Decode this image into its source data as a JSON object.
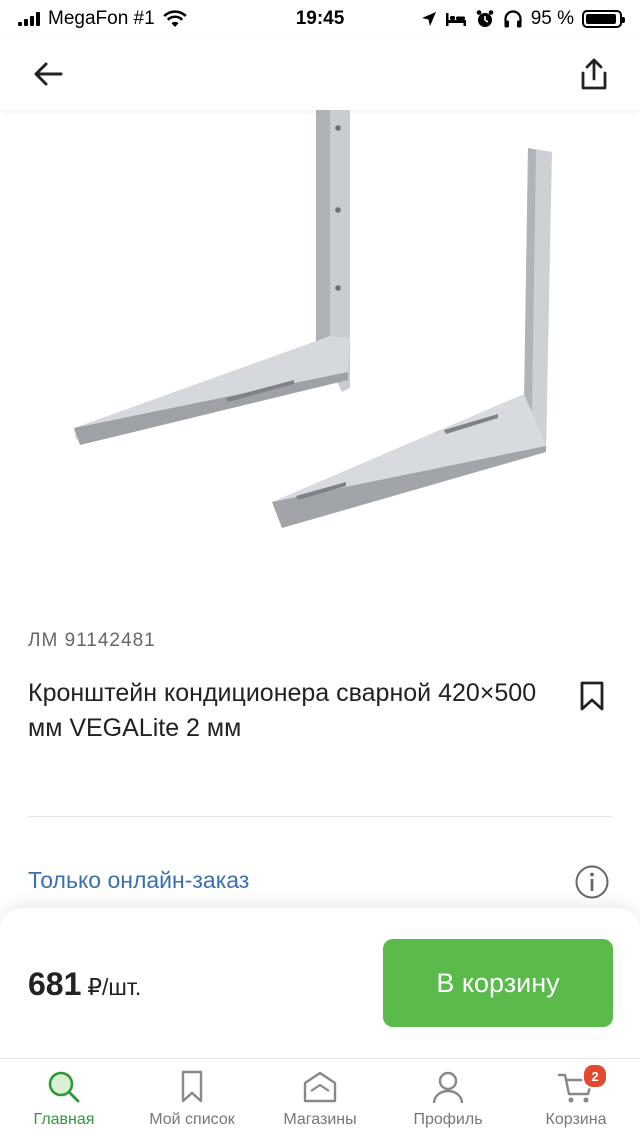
{
  "status_bar": {
    "carrier": "MegaFon #1",
    "time": "19:45",
    "battery": "95 %",
    "battery_level": 0.95
  },
  "nav": {
    "back_icon": "arrow-left-icon",
    "share_icon": "share-icon"
  },
  "product": {
    "sku": "ЛМ 91142481",
    "title": "Кронштейн кондиционера сварной 420×500 мм VEGALite 2 мм",
    "availability": "Только онлайн-заказ"
  },
  "buy": {
    "price": "681",
    "unit": "₽/шт.",
    "cart_button": "В корзину"
  },
  "tabbar": {
    "items": [
      {
        "label": "Главная",
        "icon": "search-icon",
        "active": true
      },
      {
        "label": "Мой список",
        "icon": "bookmark-icon",
        "active": false
      },
      {
        "label": "Магазины",
        "icon": "store-icon",
        "active": false
      },
      {
        "label": "Профиль",
        "icon": "user-icon",
        "active": false
      },
      {
        "label": "Корзина",
        "icon": "cart-icon",
        "active": false,
        "badge": "2"
      }
    ]
  },
  "colors": {
    "accent_green": "#5bbb4a",
    "link_blue": "#3a6fb5",
    "badge_red": "#e2492f"
  }
}
